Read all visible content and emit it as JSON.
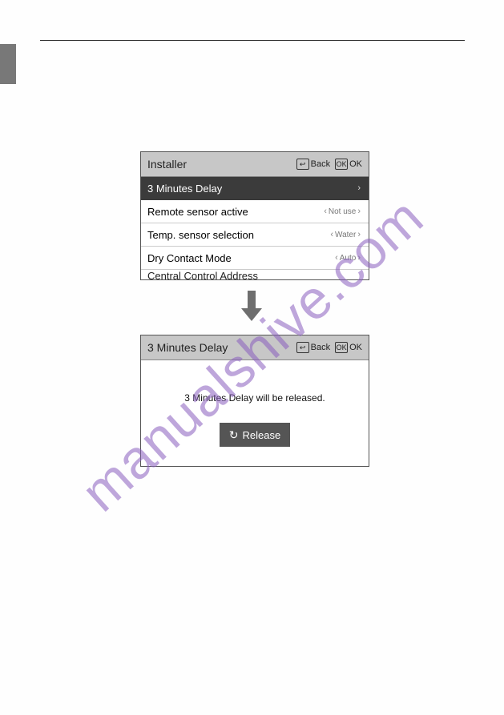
{
  "watermark": "manualshive.com",
  "screen1": {
    "title": "Installer",
    "back_label": "Back",
    "ok_label": "OK",
    "back_glyph": "↩",
    "ok_glyph": "OK",
    "rows": [
      {
        "label": "3 Minutes Delay",
        "value": "",
        "selected": true
      },
      {
        "label": "Remote sensor active",
        "value": "Not use"
      },
      {
        "label": "Temp. sensor selection",
        "value": "Water"
      },
      {
        "label": "Dry Contact Mode",
        "value": "Auto"
      }
    ],
    "cut_row_label": "Central Control Address"
  },
  "screen2": {
    "title": "3 Minutes Delay",
    "back_label": "Back",
    "ok_label": "OK",
    "back_glyph": "↩",
    "ok_glyph": "OK",
    "message": "3 Minutes Delay will be released.",
    "release_label": "Release"
  }
}
